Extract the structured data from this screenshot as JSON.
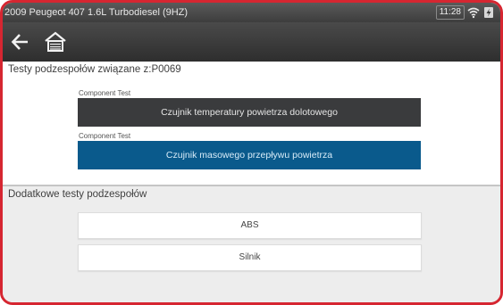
{
  "status_bar": {
    "title": "2009 Peugeot 407 1.6L Turbodiesel (9HZ)",
    "time": "11:28",
    "wifi_icon": "wifi-icon",
    "battery_icon": "battery-charging-icon"
  },
  "toolbar": {
    "back_icon": "back-arrow-icon",
    "home_icon": "home-icon"
  },
  "component_tests": {
    "header": "Testy podzespołów związane z:P0069",
    "items": [
      {
        "category": "Component Test",
        "label": "Czujnik temperatury powietrza dolotowego"
      },
      {
        "category": "Component Test",
        "label": "Czujnik masowego przepływu powietrza"
      }
    ]
  },
  "additional_tests": {
    "header": "Dodatkowe testy podzespołów",
    "items": [
      {
        "label": "ABS"
      },
      {
        "label": "Silnik"
      }
    ]
  },
  "colors": {
    "frame_border": "#d62631",
    "selected_item": "#0a5a8c",
    "dark_item": "#3a3b3d"
  }
}
